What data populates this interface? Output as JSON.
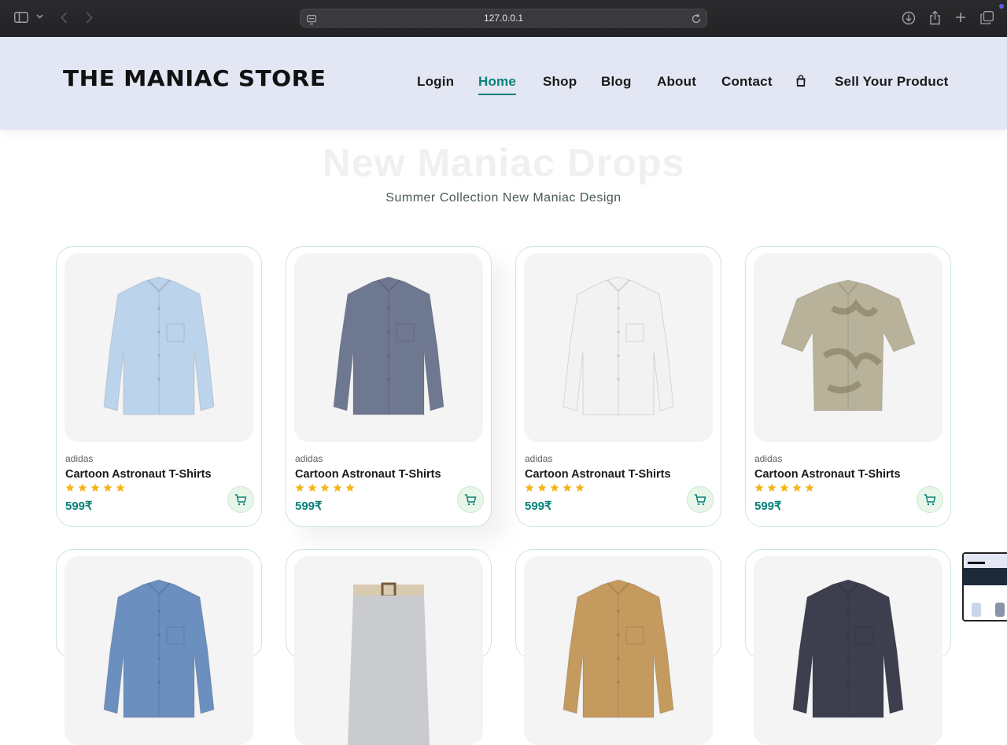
{
  "browser": {
    "url": "127.0.0.1",
    "icons": [
      "sidebar-icon",
      "chevron-down-icon",
      "back-icon",
      "forward-icon",
      "site-settings-icon",
      "reload-icon",
      "download-icon",
      "share-icon",
      "new-tab-icon",
      "tabs-overview-icon"
    ]
  },
  "header": {
    "logo": "THE MANIAC STORE",
    "nav": [
      {
        "label": "Login"
      },
      {
        "label": "Home",
        "active": true
      },
      {
        "label": "Shop"
      },
      {
        "label": "Blog"
      },
      {
        "label": "About"
      },
      {
        "label": "Contact"
      },
      {
        "label": "Sell Your Product"
      }
    ],
    "bag_icon": "shopping-bag-icon"
  },
  "hero": {
    "title": "New Maniac Drops",
    "subtitle": "Summer Collection New Maniac Design"
  },
  "products": [
    {
      "brand": "adidas",
      "name": "Cartoon Astronaut T-Shirts",
      "rating": 5,
      "price": "599₹",
      "shirt_color": "#bcd3ec"
    },
    {
      "brand": "adidas",
      "name": "Cartoon Astronaut T-Shirts",
      "rating": 5,
      "price": "599₹",
      "shirt_color": "#6f7891"
    },
    {
      "brand": "adidas",
      "name": "Cartoon Astronaut T-Shirts",
      "rating": 5,
      "price": "599₹",
      "shirt_color": "#f2f2f2"
    },
    {
      "brand": "adidas",
      "name": "Cartoon Astronaut T-Shirts",
      "rating": 5,
      "price": "599₹",
      "shirt_color": "#b8b29a"
    }
  ],
  "products_row2_colors": [
    "#6b8fbf",
    "#c9cbcf",
    "#c49a5e",
    "#3d3f4e"
  ],
  "colors": {
    "accent": "#088178",
    "header_bg": "#e3e6f3",
    "star": "#f3b519"
  }
}
